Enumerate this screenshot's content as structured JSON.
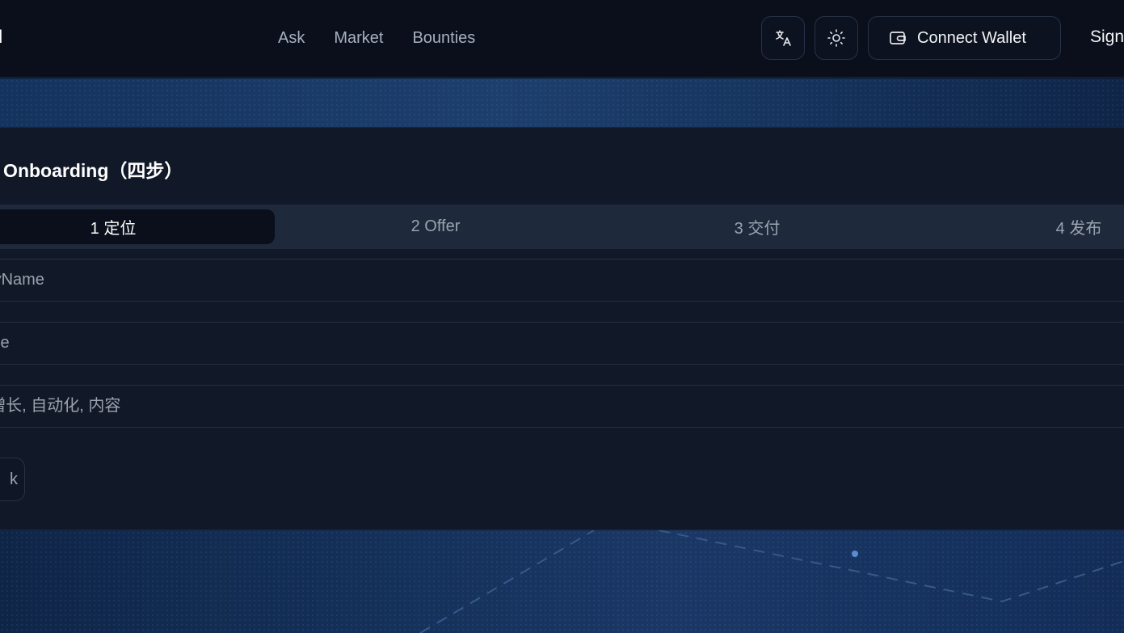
{
  "header": {
    "brand": "N",
    "nav": [
      "Ask",
      "Market",
      "Bounties"
    ],
    "connect_wallet_label": "Connect Wallet",
    "sign_in_label": "Sign"
  },
  "icons": {
    "translate": "translate-icon",
    "theme": "sun-icon",
    "wallet": "wallet-icon"
  },
  "card": {
    "title": "t Onboarding（四步）",
    "steps": [
      {
        "label": "1 定位",
        "active": true
      },
      {
        "label": "2 Offer",
        "active": false
      },
      {
        "label": "3 交付",
        "active": false
      },
      {
        "label": "4 发布",
        "active": false
      }
    ],
    "fields": [
      {
        "placeholder": "layName"
      },
      {
        "placeholder": "lline"
      },
      {
        "placeholder": ": 增长, 自动化, 内容"
      }
    ],
    "back_label": "k"
  },
  "colors": {
    "background": "#0b1020",
    "card": "#111827",
    "steps_bg": "#1e293b",
    "accent_line": "#3b5f93"
  }
}
